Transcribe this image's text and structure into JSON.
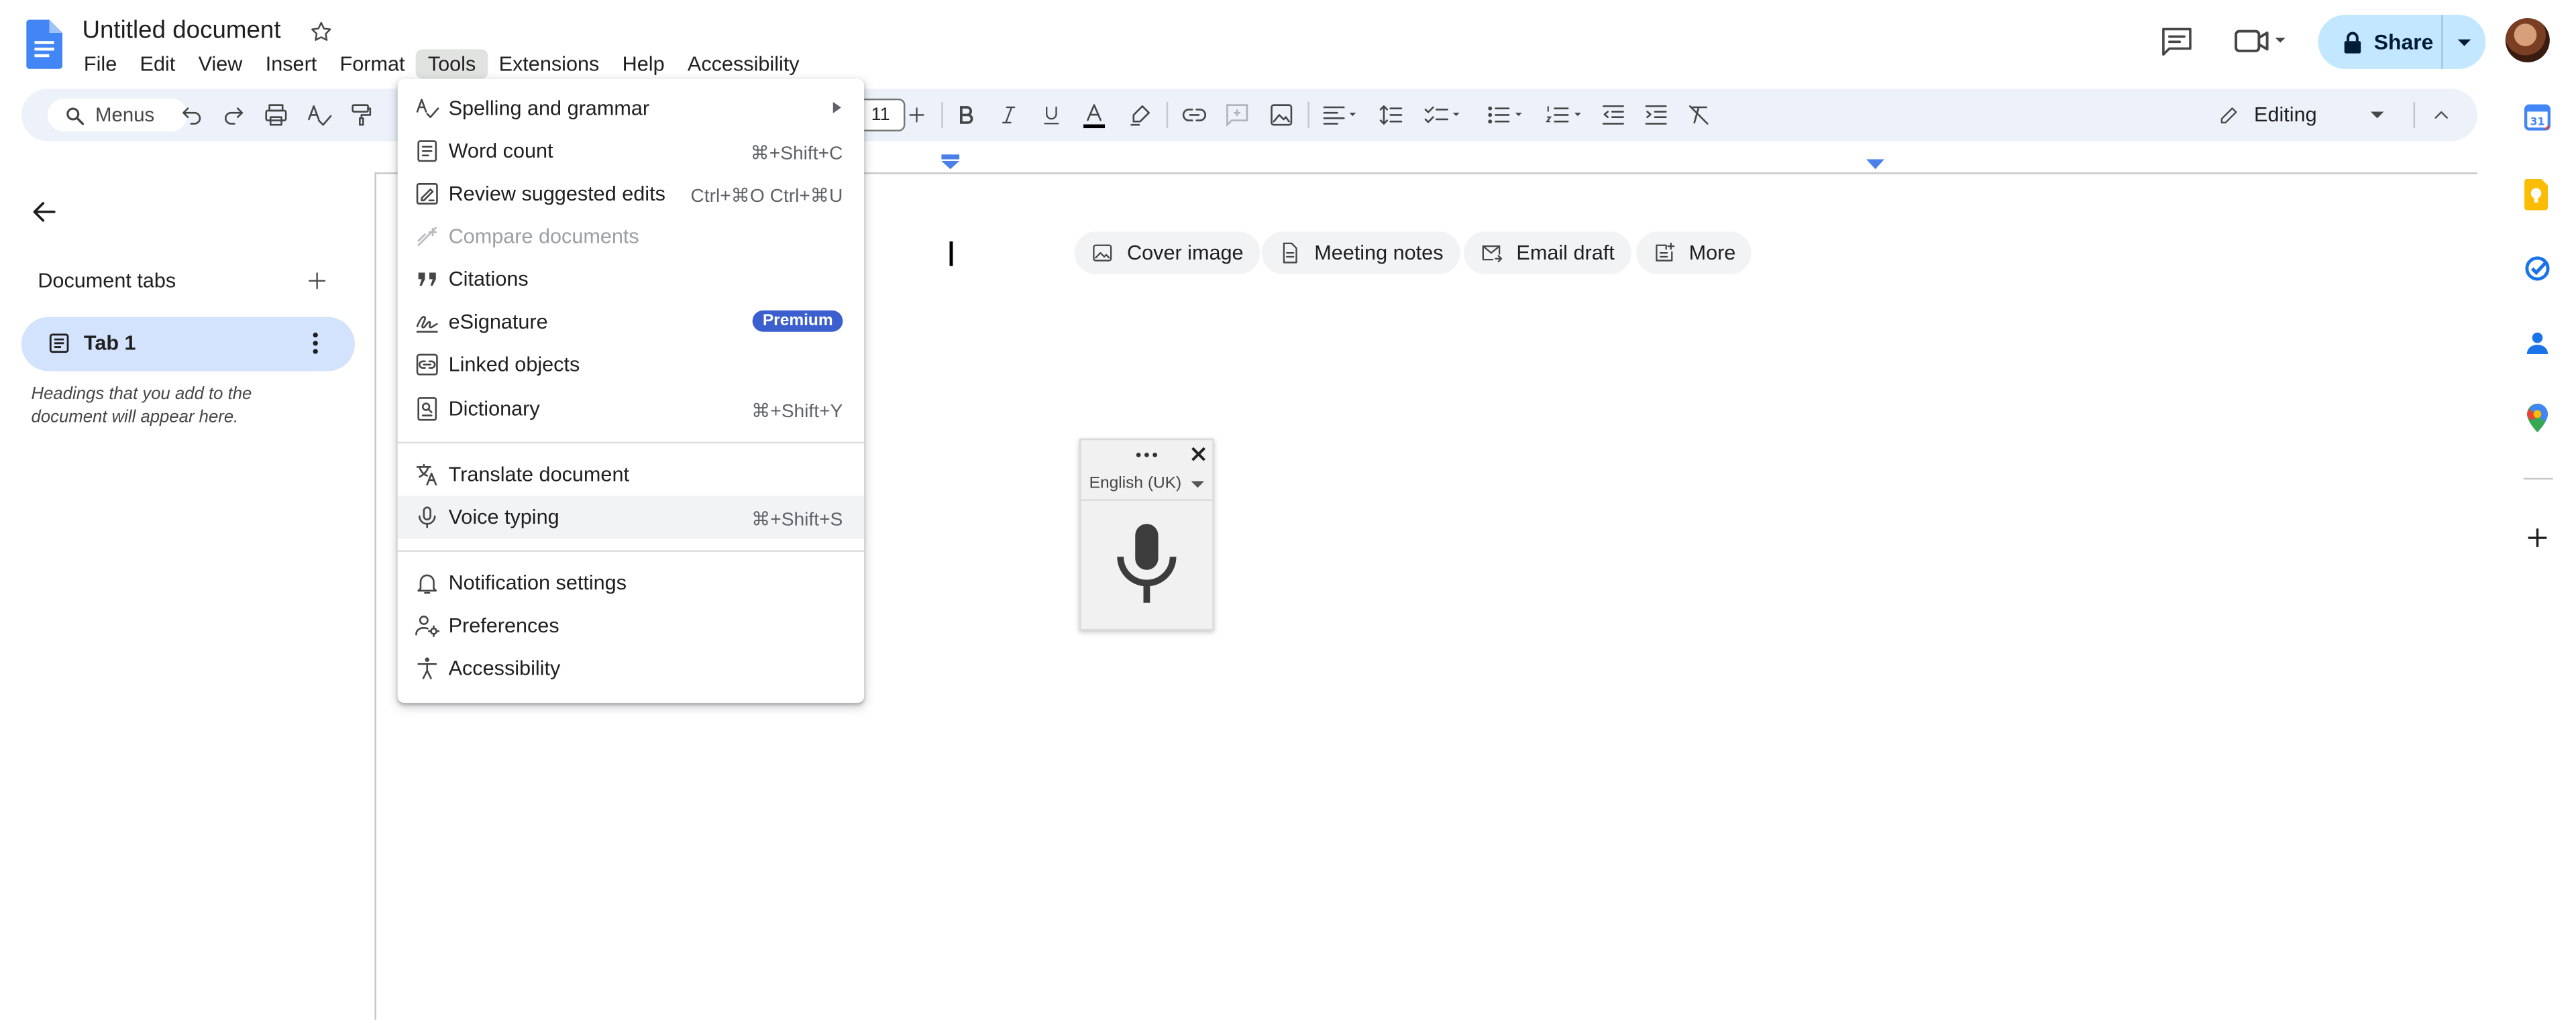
{
  "document": {
    "title": "Untitled document"
  },
  "menubar": {
    "items": [
      "File",
      "Edit",
      "View",
      "Insert",
      "Format",
      "Tools",
      "Extensions",
      "Help",
      "Accessibility"
    ],
    "active": "Tools"
  },
  "header": {
    "share_label": "Share"
  },
  "toolbar": {
    "search_label": "Menus",
    "font_size": "11",
    "mode_label": "Editing"
  },
  "left_pane": {
    "section_label": "Document tabs",
    "tab_label": "Tab 1",
    "hint": "Headings that you add to the document will appear here."
  },
  "chips": [
    "Cover image",
    "Meeting notes",
    "Email draft",
    "More"
  ],
  "voice_typing": {
    "language": "English (UK)"
  },
  "tools_menu": {
    "items": [
      {
        "label": "Spelling and grammar",
        "icon": "spellcheck-icon",
        "has_submenu": true
      },
      {
        "label": "Word count",
        "icon": "word-count-icon",
        "shortcut": "⌘+Shift+C"
      },
      {
        "label": "Review suggested edits",
        "icon": "review-edits-icon",
        "shortcut": "Ctrl+⌘O Ctrl+⌘U"
      },
      {
        "label": "Compare documents",
        "icon": "compare-icon",
        "disabled": true
      },
      {
        "label": "Citations",
        "icon": "quote-icon"
      },
      {
        "label": "eSignature",
        "icon": "signature-icon",
        "badge": "Premium"
      },
      {
        "label": "Linked objects",
        "icon": "linked-objects-icon"
      },
      {
        "label": "Dictionary",
        "icon": "dictionary-icon",
        "shortcut": "⌘+Shift+Y"
      },
      {
        "label": "Translate document",
        "icon": "translate-icon"
      },
      {
        "label": "Voice typing",
        "icon": "mic-icon",
        "shortcut": "⌘+Shift+S",
        "highlighted": true
      },
      {
        "label": "Notification settings",
        "icon": "bell-icon"
      },
      {
        "label": "Preferences",
        "icon": "preferences-icon"
      },
      {
        "label": "Accessibility",
        "icon": "accessibility-icon"
      }
    ]
  },
  "colors": {
    "accent": "#c2e7ff",
    "toolbar_bg": "#edf2fa",
    "tab_active": "#d3e3fd",
    "premium": "#3b5fcf"
  }
}
